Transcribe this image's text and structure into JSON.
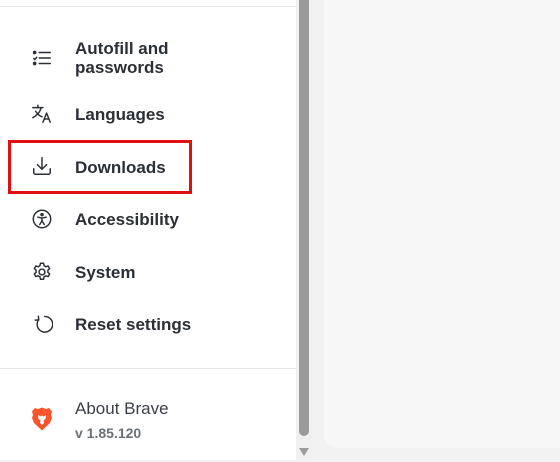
{
  "sidebar": {
    "items": [
      {
        "label": "Autofill and passwords",
        "icon": "list-icon"
      },
      {
        "label": "Languages",
        "icon": "translate-icon"
      },
      {
        "label": "Downloads",
        "icon": "download-icon"
      },
      {
        "label": "Accessibility",
        "icon": "accessibility-icon"
      },
      {
        "label": "System",
        "icon": "gear-icon"
      },
      {
        "label": "Reset settings",
        "icon": "reset-icon"
      }
    ],
    "highlighted_item": "Downloads"
  },
  "about": {
    "title": "About Brave",
    "version": "v 1.85.120",
    "icon": "brave-lion-icon"
  },
  "colors": {
    "highlight": "#e01010",
    "brave": "#fb542b",
    "text": "#2b2f36"
  }
}
